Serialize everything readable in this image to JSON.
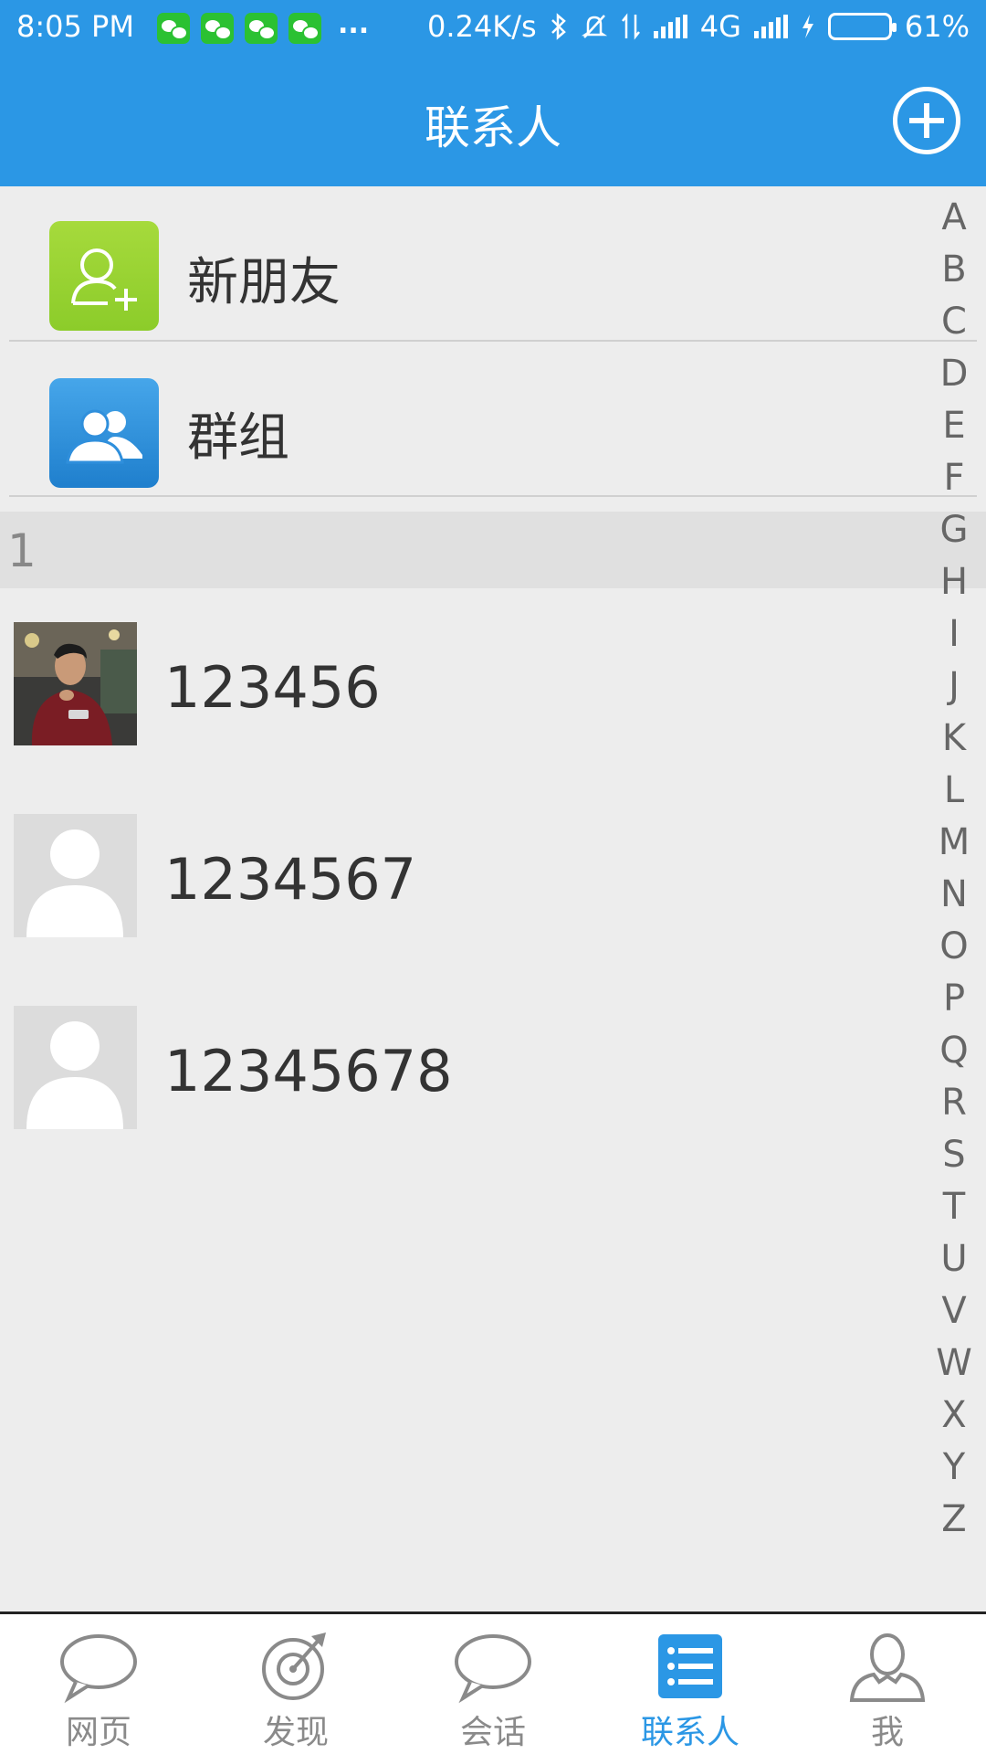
{
  "status_bar": {
    "time": "8:05 PM",
    "app_icons": [
      "wechat-icon",
      "wechat-icon",
      "wechat-icon",
      "wechat-icon"
    ],
    "more": "...",
    "speed": "0.24K/s",
    "network": "4G",
    "battery": "61%",
    "battery_level": 0.61
  },
  "header": {
    "title": "联系人",
    "add_icon": "plus-circle-icon"
  },
  "top_rows": [
    {
      "label": "新朋友",
      "icon": "add-user-icon",
      "color": "#9ad233"
    },
    {
      "label": "群组",
      "icon": "group-icon",
      "color": "#2f8fdc"
    }
  ],
  "section_header": "1",
  "contacts": [
    {
      "name": "123456",
      "avatar": "photo"
    },
    {
      "name": "1234567",
      "avatar": "default-user-icon"
    },
    {
      "name": "12345678",
      "avatar": "default-user-icon"
    }
  ],
  "alphabet": [
    "A",
    "B",
    "C",
    "D",
    "E",
    "F",
    "G",
    "H",
    "I",
    "J",
    "K",
    "L",
    "M",
    "N",
    "O",
    "P",
    "Q",
    "R",
    "S",
    "T",
    "U",
    "V",
    "W",
    "X",
    "Y",
    "Z"
  ],
  "bottom_nav": [
    {
      "label": "网页",
      "icon": "chat-bubble-icon",
      "active": false
    },
    {
      "label": "发现",
      "icon": "discover-icon",
      "active": false
    },
    {
      "label": "会话",
      "icon": "chat-bubble-icon",
      "active": false
    },
    {
      "label": "联系人",
      "icon": "contacts-list-icon",
      "active": true
    },
    {
      "label": "我",
      "icon": "person-icon",
      "active": false
    }
  ],
  "colors": {
    "primary": "#2b97e5",
    "background": "#ededed",
    "inactive": "#8a8a8a"
  }
}
